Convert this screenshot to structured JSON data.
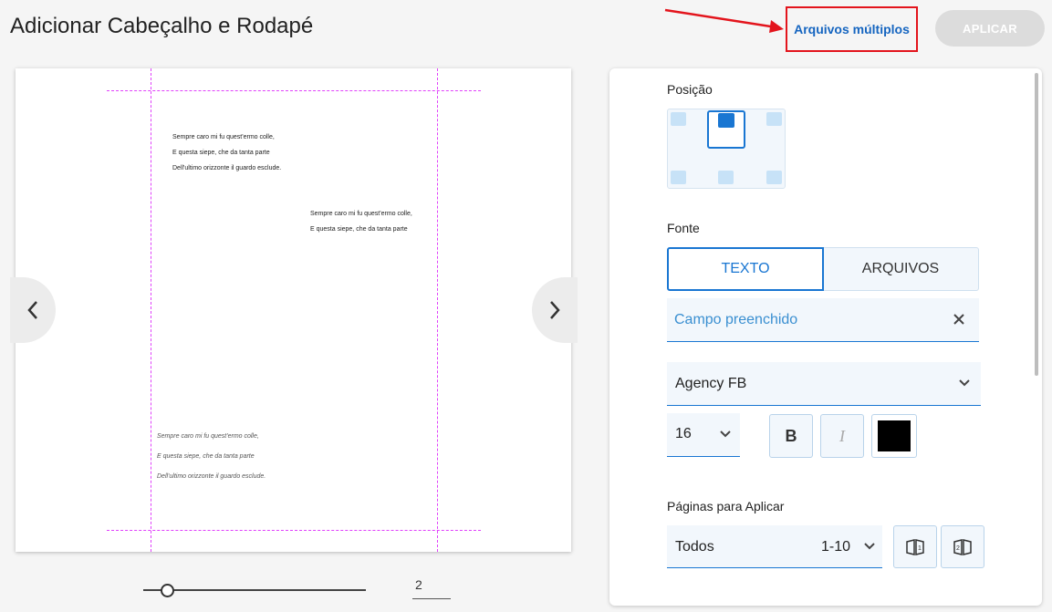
{
  "header": {
    "title": "Adicionar Cabeçalho e Rodapé",
    "multi_files_label": "Arquivos múltiplos",
    "apply_label": "APLICAR"
  },
  "colors": {
    "accent": "#1976d2",
    "highlight_box": "#e3141c",
    "guides": "#e040fb",
    "apply_disabled": "#dcdcdc"
  },
  "preview": {
    "header_lines": [
      "Sempre caro mi fu quest'ermo colle,",
      "E questa siepe, che da tanta parte",
      "Dell'ultimo orizzonte il guardo esclude."
    ],
    "mid_lines": [
      "Sempre caro mi fu quest'ermo colle,",
      "E questa siepe, che da tanta parte"
    ],
    "footer_lines": [
      "Sempre caro mi fu quest'ermo colle,",
      "E questa siepe, che da tanta parte",
      "Dell'ultimo orizzonte il guardo esclude."
    ],
    "prev_icon": "chevron-left-icon",
    "next_icon": "chevron-right-icon"
  },
  "pager": {
    "zoom_level": 0.1,
    "page_number": "2"
  },
  "panel": {
    "position_label": "Posição",
    "position_selected": "top-center",
    "source_label": "Fonte",
    "tabs": [
      {
        "label": "TEXTO",
        "active": true
      },
      {
        "label": "ARQUIVOS",
        "active": false
      }
    ],
    "text_value": "Campo preenchido",
    "clear_icon": "close-icon",
    "font_name": "Agency FB",
    "font_size": "16",
    "bold_label": "B",
    "italic_label": "I",
    "text_color": "#000000",
    "pages_label": "Páginas para Aplicar",
    "pages_value": "Todos",
    "pages_range": "1-10"
  }
}
